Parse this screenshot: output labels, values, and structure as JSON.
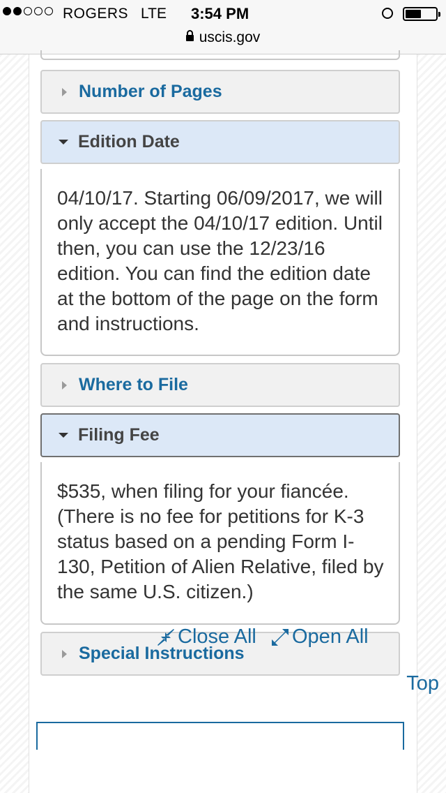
{
  "status_bar": {
    "carrier": "ROGERS",
    "network": "LTE",
    "time": "3:54 PM"
  },
  "browser": {
    "url": "uscis.gov"
  },
  "accordion": {
    "number_of_pages": {
      "title": "Number of Pages",
      "expanded": false
    },
    "edition_date": {
      "title": "Edition Date",
      "expanded": true,
      "body": "04/10/17. Starting 06/09/2017, we will only accept the 04/10/17 edition. Until then, you can use the 12/23/16 edition. You can find the edition date at the bottom of the page on the form and instructions."
    },
    "where_to_file": {
      "title": "Where to File",
      "expanded": false
    },
    "filing_fee": {
      "title": "Filing Fee",
      "expanded": true,
      "body": "$535, when filing for your fiancée. (There is no fee for petitions for K-3 status based on a pending Form I-130, Petition of Alien Relative, filed by the same U.S. citizen.)"
    },
    "special_instructions": {
      "title": "Special Instructions",
      "expanded": false
    }
  },
  "actions": {
    "close_all": "Close All",
    "open_all": "Open All"
  },
  "top_link": "Top",
  "colors": {
    "link": "#1a6a9f",
    "open_header_bg": "#dce8f7",
    "closed_header_bg": "#f1f1f1"
  }
}
